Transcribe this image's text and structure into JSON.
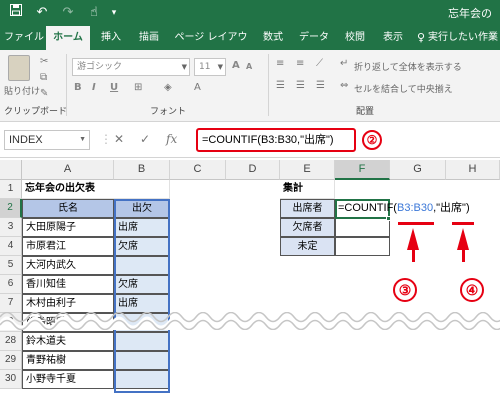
{
  "window": {
    "title": "忘年会の"
  },
  "qat": {
    "save_icon": "save-icon",
    "undo_icon": "undo-icon",
    "redo_icon": "redo-icon",
    "touch_icon": "touch-mode-icon"
  },
  "tabs": [
    "ファイル",
    "ホーム",
    "挿入",
    "描画",
    "ページ レイアウト",
    "数式",
    "データ",
    "校閲",
    "表示",
    "実行したい作業"
  ],
  "ribbon": {
    "font_name": "游ゴシック",
    "font_size": "11",
    "group_clipboard": "クリップボード",
    "group_font": "フォント",
    "group_align": "配置",
    "paste": "貼り付け",
    "wrap_text": "折り返して全体を表示する",
    "merge_center": "セルを結合して中央揃え",
    "bold": "B",
    "italic": "I",
    "underline": "U",
    "grow_font": "A",
    "shrink_font": "A"
  },
  "formula_bar": {
    "name_box": "INDEX",
    "cancel": "✕",
    "enter": "✓",
    "fx": "fx",
    "formula": "=COUNTIF(B3:B30,\"出席\")"
  },
  "columns": [
    "A",
    "B",
    "C",
    "D",
    "E",
    "F",
    "G",
    "H"
  ],
  "rows": [
    "1",
    "2",
    "3",
    "4",
    "5",
    "6",
    "7",
    "8",
    "28",
    "29",
    "30"
  ],
  "sheet": {
    "title_A1": "忘年会の出欠表",
    "header_name": "氏名",
    "header_status": "出欠",
    "summary_title": "集計",
    "summary_labels": [
      "出席者",
      "欠席者",
      "未定"
    ],
    "names": [
      "大田原陽子",
      "市原君江",
      "大河内武久",
      "香川知佳",
      "木村由利子",
      "飯島昭秀",
      "鈴木道夫",
      "青野祐樹",
      "小野寺千夏"
    ],
    "statuses": [
      "出席",
      "欠席",
      "",
      "欠席",
      "出席",
      "",
      "",
      "",
      ""
    ],
    "edit_prefix": "=COUNTIF(",
    "edit_ref": "B3:B30",
    "edit_suffix": ",\"出席\")"
  },
  "annotations": {
    "step2": "②",
    "step3": "③",
    "step4": "④"
  },
  "colors": {
    "excel_green": "#217346",
    "annotation_red": "#e60012",
    "header_blue": "#b4c6e7",
    "ref_blue": "#3c78d8"
  }
}
